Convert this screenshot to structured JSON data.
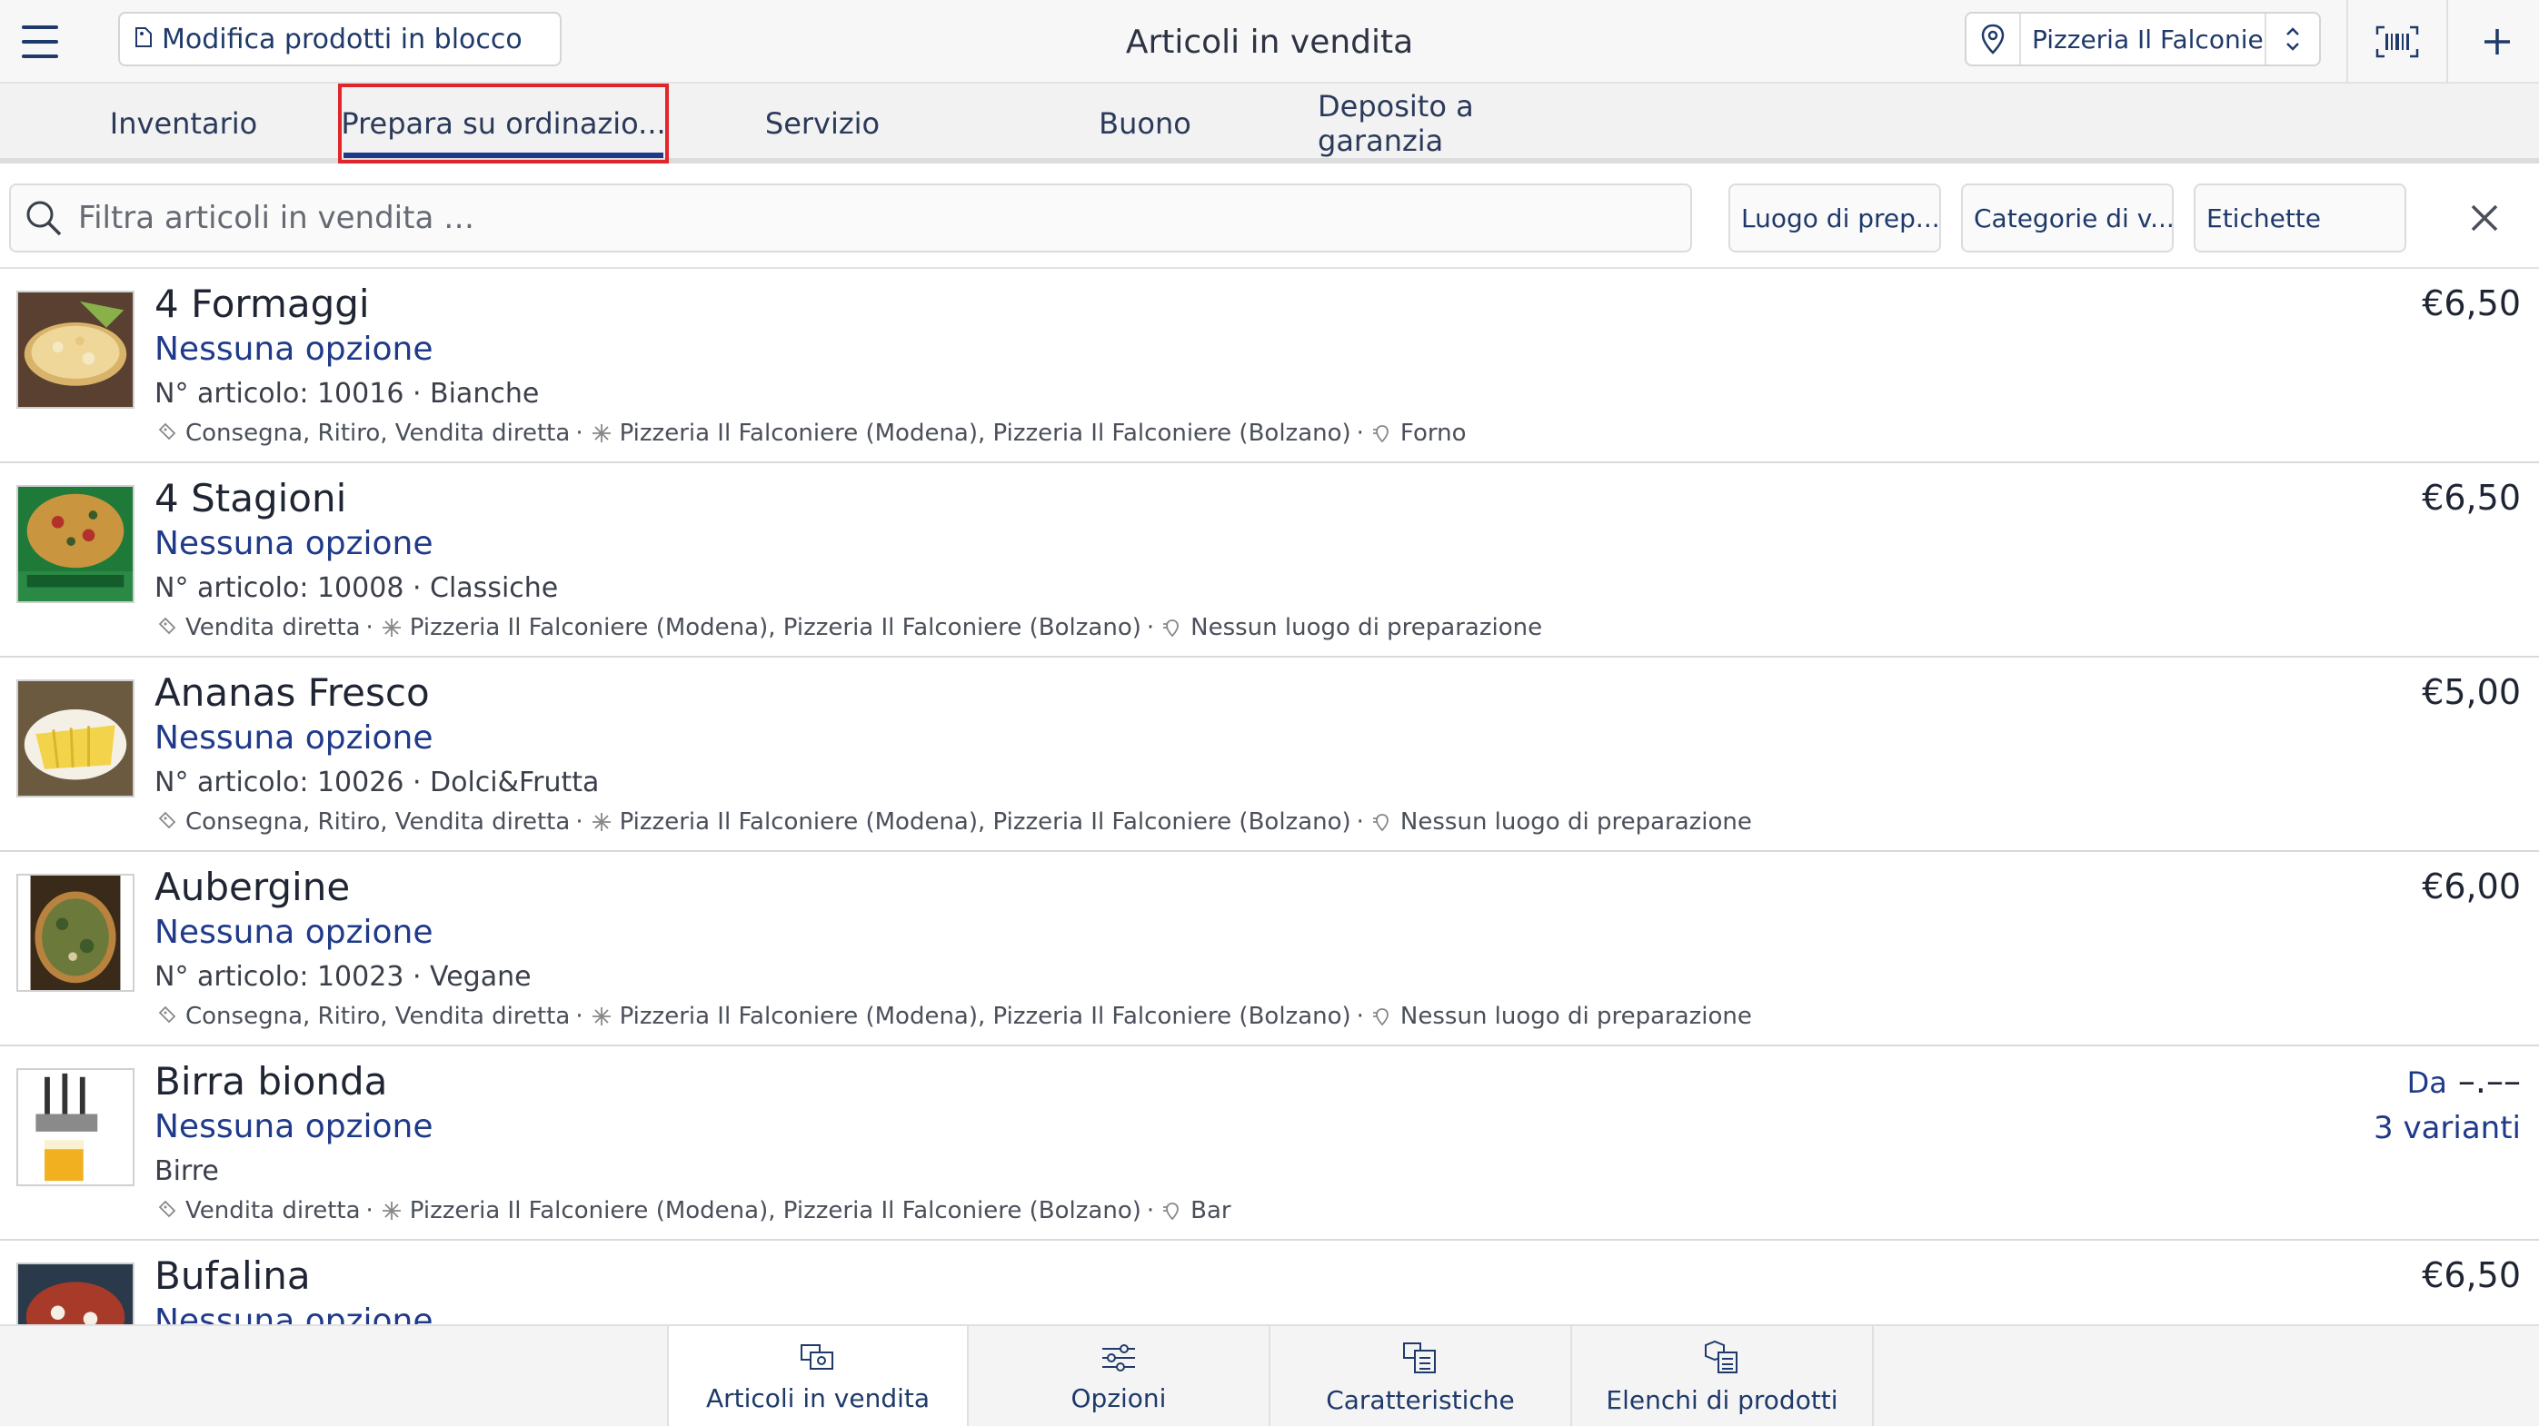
{
  "header": {
    "title": "Articoli in vendita",
    "bulk_edit_label": "Modifica prodotti in blocco",
    "location": "Pizzeria Il Falconie...",
    "menu_icon": "hamburger-icon",
    "barcode_icon": "barcode-scan-icon",
    "add_icon": "plus-icon"
  },
  "tabs": [
    {
      "label": "Inventario"
    },
    {
      "label": "Prepara su ordinazio..."
    },
    {
      "label": "Servizio"
    },
    {
      "label": "Buono"
    },
    {
      "label": "Deposito a garanzia"
    }
  ],
  "filters": {
    "search_placeholder": "Filtra articoli in vendita …",
    "chips": [
      {
        "label": "Luogo di prep..."
      },
      {
        "label": "Categorie di v..."
      },
      {
        "label": "Etichette"
      }
    ]
  },
  "items": [
    {
      "name": "4 Formaggi",
      "options": "Nessuna opzione",
      "meta": "N° articolo: 10016 · Bianche",
      "channels": "Consegna, Ritiro, Vendita diretta",
      "locations": "Pizzeria Il Falconiere (Modena), Pizzeria Il Falconiere (Bolzano)",
      "prep": "Forno",
      "price": "€6,50"
    },
    {
      "name": "4 Stagioni",
      "options": "Nessuna opzione",
      "meta": "N° articolo: 10008 · Classiche",
      "channels": "Vendita diretta",
      "locations": "Pizzeria Il Falconiere (Modena), Pizzeria Il Falconiere (Bolzano)",
      "prep": "Nessun luogo di preparazione",
      "price": "€6,50"
    },
    {
      "name": "Ananas Fresco",
      "options": "Nessuna opzione",
      "meta": "N° articolo: 10026 · Dolci&Frutta",
      "channels": "Consegna, Ritiro, Vendita diretta",
      "locations": "Pizzeria Il Falconiere (Modena), Pizzeria Il Falconiere (Bolzano)",
      "prep": "Nessun luogo di preparazione",
      "price": "€5,00"
    },
    {
      "name": "Aubergine",
      "options": "Nessuna opzione",
      "meta": "N° articolo: 10023 · Vegane",
      "channels": "Consegna, Ritiro, Vendita diretta",
      "locations": "Pizzeria Il Falconiere (Modena), Pizzeria Il Falconiere (Bolzano)",
      "prep": "Nessun luogo di preparazione",
      "price": "€6,00"
    },
    {
      "name": "Birra bionda",
      "options": "Nessuna opzione",
      "meta": "Birre",
      "channels": "Vendita diretta",
      "locations": "Pizzeria Il Falconiere (Modena), Pizzeria Il Falconiere (Bolzano)",
      "prep": "Bar",
      "price_prefix": "Da",
      "price": "–.––",
      "variants": "3 varianti"
    },
    {
      "name": "Bufalina",
      "options": "Nessuna opzione",
      "price": "€6,50"
    }
  ],
  "bottom_nav": [
    {
      "label": "Articoli in vendita",
      "icon": "sale-items-icon"
    },
    {
      "label": "Opzioni",
      "icon": "sliders-icon"
    },
    {
      "label": "Caratteristiche",
      "icon": "characteristics-icon"
    },
    {
      "label": "Elenchi di prodotti",
      "icon": "product-lists-icon"
    }
  ],
  "colors": {
    "accent": "#1f3a8a",
    "highlight_box": "#e0262a"
  }
}
